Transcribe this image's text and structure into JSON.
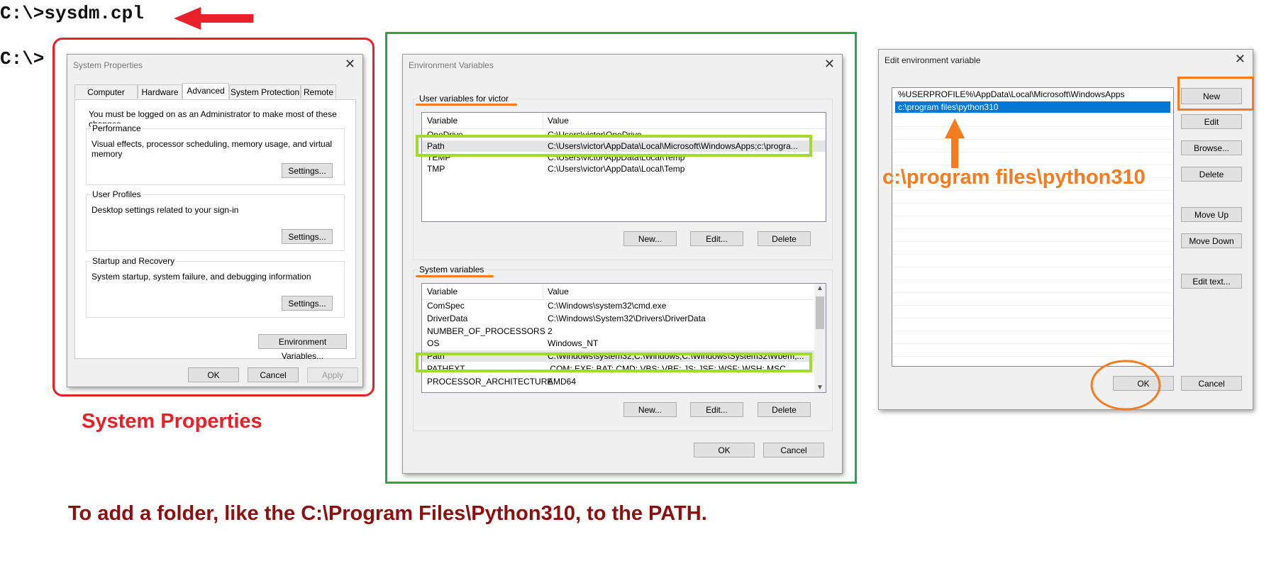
{
  "cmd": {
    "line1": "C:\\>sysdm.cpl",
    "line2": "C:\\>"
  },
  "labels": {
    "system_properties": "System Properties",
    "python_path": "c:\\program files\\python310",
    "instruction": "To add a folder, like the C:\\Program Files\\Python310, to the PATH."
  },
  "colors": {
    "red": "#e8202a",
    "green": "#22aa44",
    "orange": "#f47b20",
    "dark_red": "#8b1010",
    "lime": "#a4d932",
    "selection": "#0078d7"
  },
  "sysprops": {
    "title": "System Properties",
    "tabs": [
      "Computer Name",
      "Hardware",
      "Advanced",
      "System Protection",
      "Remote"
    ],
    "admin_note": "You must be logged on as an Administrator to make most of these changes.",
    "performance": {
      "label": "Performance",
      "desc": "Visual effects, processor scheduling, memory usage, and virtual memory",
      "button": "Settings..."
    },
    "profiles": {
      "label": "User Profiles",
      "desc": "Desktop settings related to your sign-in",
      "button": "Settings..."
    },
    "startup": {
      "label": "Startup and Recovery",
      "desc": "System startup, system failure, and debugging information",
      "button": "Settings..."
    },
    "env_button": "Environment Variables...",
    "ok": "OK",
    "cancel": "Cancel",
    "apply": "Apply"
  },
  "envvars": {
    "title": "Environment Variables",
    "user_label": "User variables for victor",
    "system_label": "System variables",
    "col_variable": "Variable",
    "col_value": "Value",
    "user_rows": [
      {
        "variable": "OneDrive",
        "value": "C:\\Users\\victor\\OneDrive"
      },
      {
        "variable": "Path",
        "value": "C:\\Users\\victor\\AppData\\Local\\Microsoft\\WindowsApps;c:\\progra..."
      },
      {
        "variable": "TEMP",
        "value": "C:\\Users\\victor\\AppData\\Local\\Temp"
      },
      {
        "variable": "TMP",
        "value": "C:\\Users\\victor\\AppData\\Local\\Temp"
      }
    ],
    "system_rows": [
      {
        "variable": "ComSpec",
        "value": "C:\\Windows\\system32\\cmd.exe"
      },
      {
        "variable": "DriverData",
        "value": "C:\\Windows\\System32\\Drivers\\DriverData"
      },
      {
        "variable": "NUMBER_OF_PROCESSORS",
        "value": "2"
      },
      {
        "variable": "OS",
        "value": "Windows_NT"
      },
      {
        "variable": "Path",
        "value": "C:\\Windows\\system32;C:\\Windows;C:\\Windows\\System32\\Wbem;..."
      },
      {
        "variable": "PATHEXT",
        "value": ".COM;.EXE;.BAT;.CMD;.VBS;.VBE;.JS;.JSE;.WSF;.WSH;.MSC"
      },
      {
        "variable": "PROCESSOR_ARCHITECTURE",
        "value": "AMD64"
      }
    ],
    "new": "New...",
    "edit": "Edit...",
    "delete": "Delete",
    "ok": "OK",
    "cancel": "Cancel"
  },
  "editenv": {
    "title": "Edit environment variable",
    "entries": [
      "%USERPROFILE%\\AppData\\Local\\Microsoft\\WindowsApps",
      "c:\\program files\\python310"
    ],
    "new": "New",
    "edit": "Edit",
    "browse": "Browse...",
    "delete": "Delete",
    "move_up": "Move Up",
    "move_down": "Move Down",
    "edit_text": "Edit text...",
    "ok": "OK",
    "cancel": "Cancel"
  }
}
